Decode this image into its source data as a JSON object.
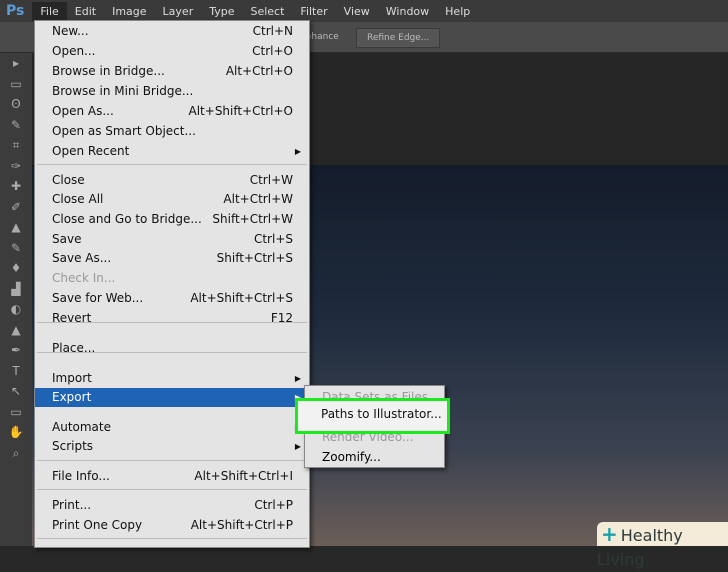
{
  "app_logo": "Ps",
  "menubar": [
    "File",
    "Edit",
    "Image",
    "Layer",
    "Type",
    "Select",
    "Filter",
    "View",
    "Window",
    "Help"
  ],
  "options_bar": {
    "enhance": "Enhance",
    "refine_edge": "Refine Edge..."
  },
  "file_menu": [
    {
      "label": "New...",
      "shortcut": "Ctrl+N"
    },
    {
      "label": "Open...",
      "shortcut": "Ctrl+O"
    },
    {
      "label": "Browse in Bridge...",
      "shortcut": "Alt+Ctrl+O"
    },
    {
      "label": "Browse in Mini Bridge...",
      "shortcut": ""
    },
    {
      "label": "Open As...",
      "shortcut": "Alt+Shift+Ctrl+O"
    },
    {
      "label": "Open as Smart Object...",
      "shortcut": ""
    },
    {
      "label": "Open Recent",
      "shortcut": "",
      "submenu": true
    },
    {
      "label": "Close",
      "shortcut": "Ctrl+W"
    },
    {
      "label": "Close All",
      "shortcut": "Alt+Ctrl+W"
    },
    {
      "label": "Close and Go to Bridge...",
      "shortcut": "Shift+Ctrl+W"
    },
    {
      "label": "Save",
      "shortcut": "Ctrl+S"
    },
    {
      "label": "Save As...",
      "shortcut": "Shift+Ctrl+S"
    },
    {
      "label": "Check In...",
      "shortcut": "",
      "disabled": true
    },
    {
      "label": "Save for Web...",
      "shortcut": "Alt+Shift+Ctrl+S"
    },
    {
      "label": "Revert",
      "shortcut": "F12"
    },
    {
      "label": "Place...",
      "shortcut": ""
    },
    {
      "label": "Import",
      "shortcut": "",
      "submenu": true
    },
    {
      "label": "Export",
      "shortcut": "",
      "submenu": true,
      "highlighted": true
    },
    {
      "label": "Automate",
      "shortcut": "",
      "submenu": true
    },
    {
      "label": "Scripts",
      "shortcut": "",
      "submenu": true
    },
    {
      "label": "File Info...",
      "shortcut": "Alt+Shift+Ctrl+I"
    },
    {
      "label": "Print...",
      "shortcut": "Ctrl+P"
    },
    {
      "label": "Print One Copy",
      "shortcut": "Alt+Shift+Ctrl+P"
    }
  ],
  "export_submenu": [
    {
      "label": "Data Sets as Files...",
      "disabled": true
    },
    {
      "label": "Paths to Illustrator...",
      "highlighted": true
    },
    {
      "label": "Render Video...",
      "disabled": true
    },
    {
      "label": "Zoomify..."
    }
  ],
  "watermark": "Healthy Living"
}
